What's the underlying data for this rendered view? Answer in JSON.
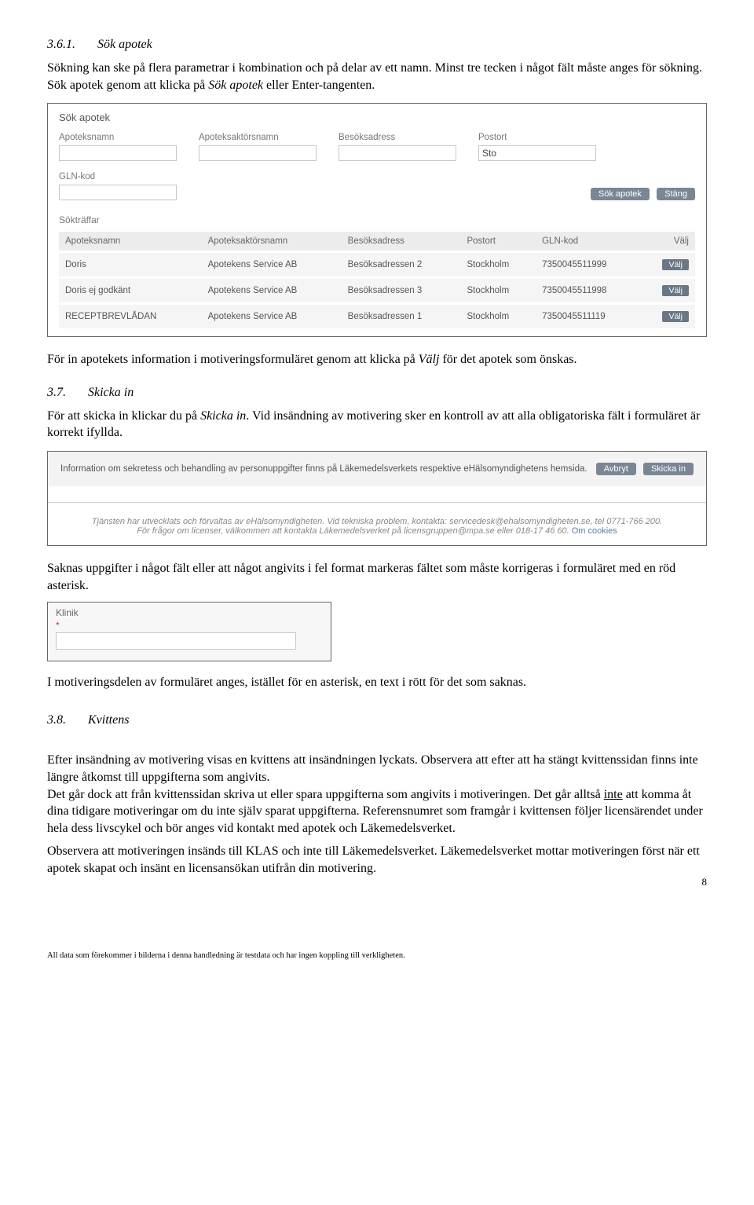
{
  "sec361": {
    "num": "3.6.1.",
    "title": "Sök apotek",
    "p1a": "Sökning kan ske på flera parametrar i kombination och på delar av ett namn. Minst tre tecken i något fält måste anges för sökning. Sök apotek genom att klicka på ",
    "p1i": "Sök apotek",
    "p1b": " eller Enter-tangenten."
  },
  "shot1": {
    "title": "Sök apotek",
    "labels": {
      "a": "Apoteksnamn",
      "b": "Apoteksaktörsnamn",
      "c": "Besöksadress",
      "d": "Postort",
      "e": "GLN-kod"
    },
    "postort_value": "Sto",
    "btn_search": "Sök apotek",
    "btn_close": "Stäng",
    "sub": "Sökträffar",
    "head": {
      "a": "Apoteksnamn",
      "b": "Apoteksaktörsnamn",
      "c": "Besöksadress",
      "d": "Postort",
      "e": "GLN-kod",
      "f": "Välj"
    },
    "rows": [
      {
        "a": "Doris",
        "b": "Apotekens Service AB",
        "c": "Besöksadressen 2",
        "d": "Stockholm",
        "e": "7350045511999",
        "f": "Välj"
      },
      {
        "a": "Doris ej godkänt",
        "b": "Apotekens Service AB",
        "c": "Besöksadressen 3",
        "d": "Stockholm",
        "e": "7350045511998",
        "f": "Välj"
      },
      {
        "a": "RECEPTBREVLÅDAN",
        "b": "Apotekens Service AB",
        "c": "Besöksadressen 1",
        "d": "Stockholm",
        "e": "7350045511119",
        "f": "Välj"
      }
    ]
  },
  "afterShot1": {
    "a": "För in apotekets information i motiveringsformuläret genom att klicka på ",
    "i": "Välj",
    "b": " för det apotek som önskas."
  },
  "sec37": {
    "num": "3.7.",
    "title": "Skicka in",
    "p1a": "För att skicka in klickar du på ",
    "p1i": "Skicka in",
    "p1b": ". Vid insändning av motivering sker en kontroll av att alla obligatoriska fält i formuläret är korrekt ifyllda."
  },
  "shot2": {
    "info": "Information om sekretess och behandling av personuppgifter finns på Läkemedelsverkets respektive eHälsomyndighetens hemsida.",
    "btn_cancel": "Avbryt",
    "btn_send": "Skicka in",
    "foot1": "Tjänsten har utvecklats och förvaltas av eHälsomyndigheten. Vid tekniska problem, kontakta: servicedesk@ehalsomyndigheten.se, tel 0771-766 200.",
    "foot2a": "För frågor om licenser, välkommen att kontakta Läkemedelsverket på licensgruppen@mpa.se eller 018-17 46 60. ",
    "foot2link": "Om cookies"
  },
  "belowShot2": "Saknas uppgifter i något fält eller att något angivits i fel format markeras fältet som måste korrigeras i formuläret med en röd asterisk.",
  "shot3": {
    "label": "Klinik",
    "ast": "*"
  },
  "belowShot3": "I motiveringsdelen av formuläret anges, istället för en asterisk, en text i rött för det som saknas.",
  "sec38": {
    "num": "3.8.",
    "title": "Kvittens",
    "p1a": "Efter insändning av motivering visas en kvittens att insändningen lyckats. Observera att efter att ha stängt kvittenssidan finns inte längre åtkomst till uppgifterna som angivits.\nDet går dock att från kvittenssidan skriva ut eller spara uppgifterna som angivits i motiveringen. Det går alltså ",
    "p1u": "inte",
    "p1b": " att komma åt dina tidigare motiveringar om du inte själv sparat uppgifterna. Referensnumret som framgår i kvittensen följer licensärendet under hela dess livscykel och bör anges vid kontakt med apotek och Läkemedelsverket.",
    "p2": "Observera att motiveringen insänds till KLAS och inte till Läkemedelsverket. Läkemedelsverket mottar motiveringen först när ett apotek skapat och insänt en licensansökan utifrån din motivering."
  },
  "footer": "All data som förekommer i bilderna i denna handledning är testdata och har ingen koppling till verkligheten.",
  "page": "8"
}
